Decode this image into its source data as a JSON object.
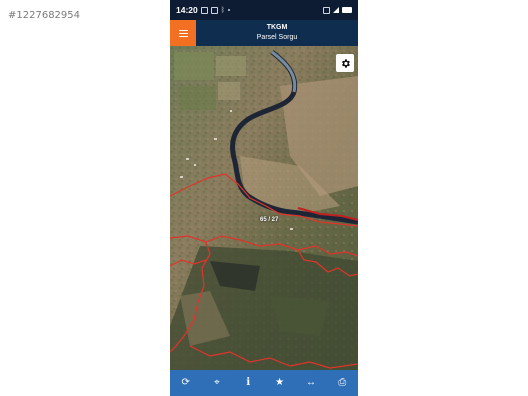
{
  "watermark": "#1227682954",
  "statusbar": {
    "time": "14:20",
    "icons_left": [
      "gallery-icon",
      "image-icon",
      "bluetooth-icon",
      "dot-icon"
    ],
    "icons_right": [
      "alarm-icon",
      "signal-icon",
      "battery-icon"
    ]
  },
  "appbar": {
    "title": "TKGM",
    "subtitle": "Parsel Sorgu",
    "accent": "#f36f21",
    "background": "#0e2d4f"
  },
  "map": {
    "parcel_label": "65 / 27",
    "boundary_color": "#e0342b",
    "settings_icon": "gear-icon"
  },
  "bottombar": {
    "background": "#2f6fb7",
    "buttons": [
      {
        "name": "refresh-button",
        "icon": "refresh-icon",
        "glyph": "⟳"
      },
      {
        "name": "locate-button",
        "icon": "crosshair-icon",
        "glyph": "⌖"
      },
      {
        "name": "info-button",
        "icon": "info-icon",
        "glyph": "i"
      },
      {
        "name": "favorite-button",
        "icon": "star-icon",
        "glyph": "★"
      },
      {
        "name": "measure-button",
        "icon": "measure-icon",
        "glyph": "↔"
      },
      {
        "name": "print-button",
        "icon": "print-icon",
        "glyph": "⎙"
      }
    ]
  }
}
